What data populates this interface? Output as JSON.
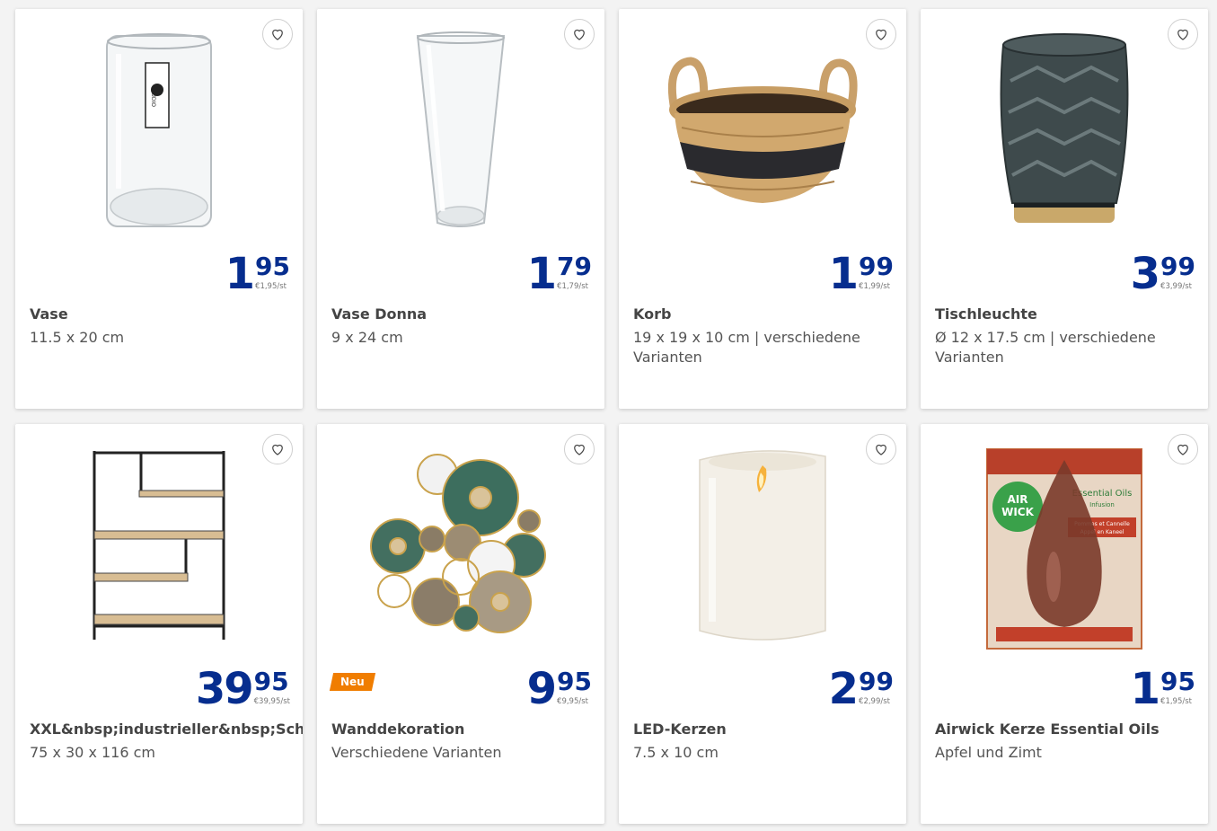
{
  "products": [
    {
      "name": "Vase",
      "desc": "11.5 x 20 cm",
      "price_int": "1",
      "price_dec": "95",
      "unit": "€1,95/st",
      "badge": ""
    },
    {
      "name": "Vase Donna",
      "desc": "9 x 24 cm",
      "price_int": "1",
      "price_dec": "79",
      "unit": "€1,79/st",
      "badge": ""
    },
    {
      "name": "Korb",
      "desc": "19 x 19 x 10 cm | verschiedene Varianten",
      "price_int": "1",
      "price_dec": "99",
      "unit": "€1,99/st",
      "badge": ""
    },
    {
      "name": "Tischleuchte",
      "desc": "Ø 12 x 17.5 cm | verschiedene Varianten",
      "price_int": "3",
      "price_dec": "99",
      "unit": "€3,99/st",
      "badge": ""
    },
    {
      "name": "XXL&nbsp;industrieller&nbsp;Schrank",
      "desc": "75 x 30 x 116 cm",
      "price_int": "39",
      "price_dec": "95",
      "unit": "€39,95/st",
      "badge": ""
    },
    {
      "name": "Wanddekoration",
      "desc": "Verschiedene Varianten",
      "price_int": "9",
      "price_dec": "95",
      "unit": "€9,95/st",
      "badge": "Neu"
    },
    {
      "name": "LED-Kerzen",
      "desc": "7.5 x 10 cm",
      "price_int": "2",
      "price_dec": "99",
      "unit": "€2,99/st",
      "badge": ""
    },
    {
      "name": "Airwick Kerze Essential Oils",
      "desc": "Apfel und Zimt",
      "price_int": "1",
      "price_dec": "95",
      "unit": "€1,95/st",
      "badge": ""
    }
  ],
  "airwick": {
    "brand_1": "AIR",
    "brand_2": "WICK",
    "line": "Essential Oils",
    "sub": "Infusion",
    "scent_1": "Pommes et Cannelle",
    "scent_2": "Appel en Kaneel"
  },
  "vase_label": "STUDIO",
  "icons": {
    "favorite": "heart-outline-icon"
  },
  "colors": {
    "price": "#062d8e",
    "badge": "#f07d00",
    "background": "#f3f3f3"
  }
}
